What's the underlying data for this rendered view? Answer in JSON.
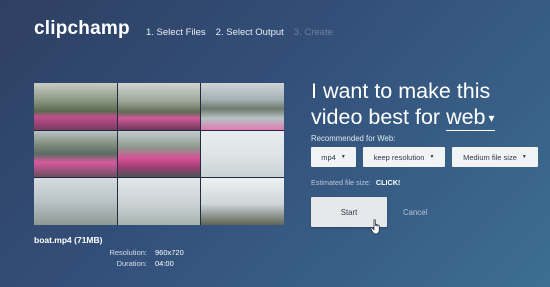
{
  "app": {
    "logo_text": "clipchamp"
  },
  "steps": [
    {
      "label": "1. Select Files",
      "state": "done"
    },
    {
      "label": "2. Select Output",
      "state": "done"
    },
    {
      "label": "3. Create",
      "state": "pending"
    }
  ],
  "file": {
    "name": "boat.mp4 (71MB)",
    "resolution_label": "Resolution:",
    "resolution_value": "960x720",
    "duration_label": "Duration:",
    "duration_value": "04:00"
  },
  "headline": {
    "text": "I want to make this video best for",
    "target_value": "web",
    "target_caret": "▾"
  },
  "recommended": {
    "label": "Recommended for Web:",
    "format": "mp4",
    "resolution": "keep resolution",
    "file_size": "Medium file size",
    "caret": "▼"
  },
  "estimate": {
    "label": "Estimated file size:",
    "action": "CLICK!"
  },
  "actions": {
    "start_label": "Start",
    "cancel_label": "Cancel"
  },
  "colors": {
    "background": "#33507a",
    "button": "#e7e8e9"
  },
  "icons": {
    "cursor": "hand-pointer-icon"
  }
}
